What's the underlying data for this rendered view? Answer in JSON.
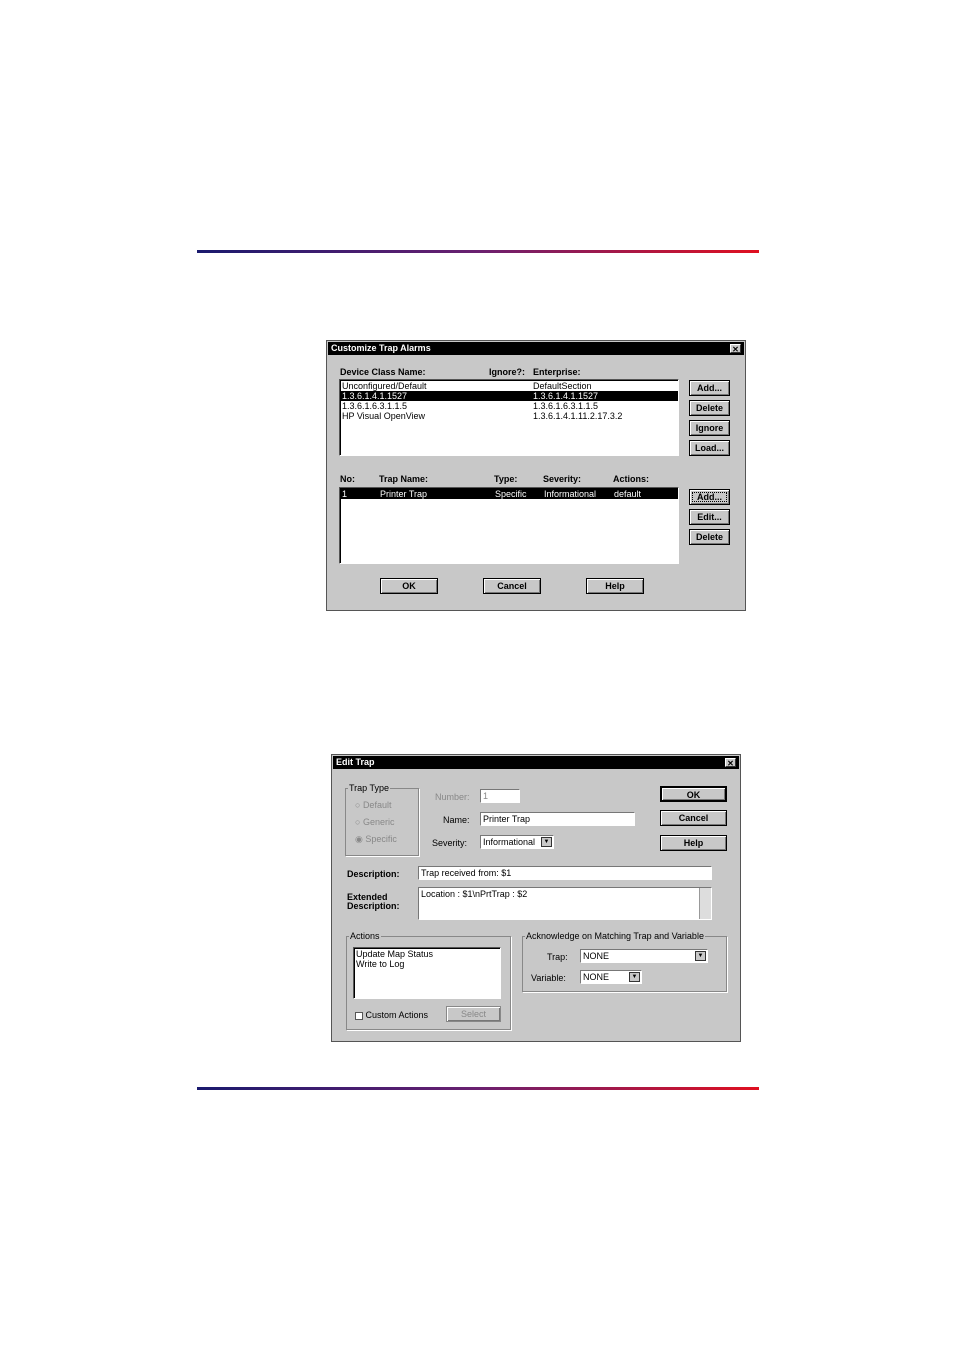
{
  "dialog1": {
    "title": "Customize Trap Alarms",
    "headers": {
      "device_class": "Device Class Name:",
      "ignore": "Ignore?:",
      "enterprise": "Enterprise:"
    },
    "devices": [
      {
        "name": "Unconfigured/Default",
        "enterprise": "DefaultSection"
      },
      {
        "name": "1.3.6.1.4.1.1527",
        "enterprise": "1.3.6.1.4.1.1527",
        "selected": true
      },
      {
        "name": "1.3.6.1.6.3.1.1.5",
        "enterprise": "1.3.6.1.6.3.1.1.5"
      },
      {
        "name": "HP Visual OpenView",
        "enterprise": "1.3.6.1.4.1.11.2.17.3.2"
      }
    ],
    "device_buttons": [
      "Add...",
      "Delete",
      "Ignore",
      "Load..."
    ],
    "trap_headers": {
      "no": "No:",
      "name": "Trap Name:",
      "type": "Type:",
      "severity": "Severity:",
      "actions": "Actions:"
    },
    "traps": [
      {
        "no": "1",
        "name": "Printer Trap",
        "type": "Specific",
        "severity": "Informational",
        "actions": "default"
      }
    ],
    "trap_buttons": [
      "Add...",
      "Edit...",
      "Delete"
    ],
    "footer": [
      "OK",
      "Cancel",
      "Help"
    ]
  },
  "dialog2": {
    "title": "Edit Trap",
    "trap_type": {
      "label": "Trap Type",
      "options": [
        "Default",
        "Generic",
        "Specific"
      ],
      "selected": "Specific"
    },
    "number_label": "Number:",
    "number": "1",
    "name_label": "Name:",
    "name": "Printer Trap",
    "severity_label": "Severity:",
    "severity": "Informational",
    "buttons": [
      "OK",
      "Cancel",
      "Help"
    ],
    "description_label": "Description:",
    "description": "Trap received from: $1",
    "ext_label1": "Extended",
    "ext_label2": "Description:",
    "ext_description": "Location : $1\\nPrtTrap : $2",
    "actions": {
      "label": "Actions",
      "items": [
        "Update Map Status",
        "Write to Log"
      ],
      "custom_label": "Custom Actions",
      "custom_checked": false,
      "select": "Select"
    },
    "ack": {
      "label": "Acknowledge on Matching Trap and Variable",
      "trap_label": "Trap:",
      "trap": "NONE",
      "variable_label": "Variable:",
      "variable": "NONE"
    }
  }
}
